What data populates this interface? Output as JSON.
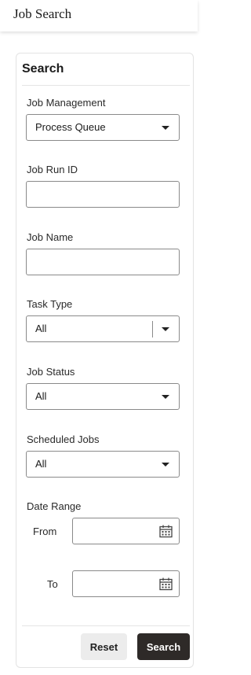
{
  "header": {
    "title": "Job Search"
  },
  "panel": {
    "title": "Search"
  },
  "fields": {
    "job_management": {
      "label": "Job Management",
      "value": "Process Queue"
    },
    "job_run_id": {
      "label": "Job Run ID",
      "value": ""
    },
    "job_name": {
      "label": "Job Name",
      "value": ""
    },
    "task_type": {
      "label": "Task Type",
      "value": "All"
    },
    "job_status": {
      "label": "Job Status",
      "value": "All"
    },
    "scheduled_jobs": {
      "label": "Scheduled Jobs",
      "value": "All"
    },
    "date_range": {
      "label": "Date Range",
      "from_label": "From",
      "to_label": "To",
      "from_value": "",
      "to_value": ""
    }
  },
  "buttons": {
    "reset": "Reset",
    "search": "Search"
  },
  "icons": {
    "dropdown": "chevron-down-icon",
    "date": "calendar-icon"
  },
  "colors": {
    "primary_button": "#2e2a28",
    "secondary_button": "#ececec",
    "border": "#8a8a8a"
  }
}
